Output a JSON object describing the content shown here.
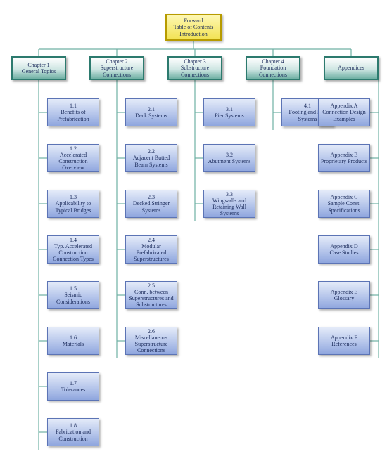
{
  "root": {
    "line1": "Forward",
    "line2": "Table of Contents",
    "line3": "Introduction"
  },
  "chapters": [
    {
      "line1": "Chapter 1",
      "line2": "General Topics"
    },
    {
      "line1": "Chapter 2",
      "line2": "Superstructure",
      "line3": "Connections"
    },
    {
      "line1": "Chapter 3",
      "line2": "Substructure",
      "line3": "Connections"
    },
    {
      "line1": "Chapter 4",
      "line2": "Foundation",
      "line3": "Connections"
    },
    {
      "line1": "Appendices"
    }
  ],
  "col1": [
    {
      "num": "1.1",
      "title": "Benefits of Prefabrication"
    },
    {
      "num": "1.2",
      "title": "Accelerated Construction Overview"
    },
    {
      "num": "1.3",
      "title": "Applicability to Typical Bridges"
    },
    {
      "num": "1.4",
      "title": "Typ. Accelerated Construction Connection  Types"
    },
    {
      "num": "1.5",
      "title": "Seismic Considerations"
    },
    {
      "num": "1.6",
      "title": "Materials"
    },
    {
      "num": "1.7",
      "title": "Tolerances"
    },
    {
      "num": "1.8",
      "title": "Fabrication and Construction"
    }
  ],
  "col2": [
    {
      "num": "2.1",
      "title": "Deck Systems"
    },
    {
      "num": "2.2",
      "title": "Adjacent Butted Beam Systems"
    },
    {
      "num": "2.3",
      "title": "Decked Stringer Systems"
    },
    {
      "num": "2.4",
      "title": "Modular Prefabricated Superstructures"
    },
    {
      "num": "2.5",
      "title": "Conn. between Superstructures and Substructures"
    },
    {
      "num": "2.6",
      "title": "Miscellaneous Superstructure Connections"
    }
  ],
  "col3": [
    {
      "num": "3.1",
      "title": "Pier Systems"
    },
    {
      "num": "3.2",
      "title": "Abutment Systems"
    },
    {
      "num": "3.3",
      "title": "Wingwalls and Retaining Wall Systems"
    }
  ],
  "col4": [
    {
      "num": "4.1",
      "title": "Footing and Pile Systems"
    }
  ],
  "col5": [
    {
      "num": "Appendix A",
      "title": "Connection Design Examples"
    },
    {
      "num": "Appendix B",
      "title": "Proprietary Products"
    },
    {
      "num": "Appendix C",
      "title": "Sample Const. Specifications"
    },
    {
      "num": "Appendix D",
      "title": "Case Studies"
    },
    {
      "num": "Appendix E",
      "title": "Glossary"
    },
    {
      "num": "Appendix F",
      "title": "References"
    }
  ]
}
